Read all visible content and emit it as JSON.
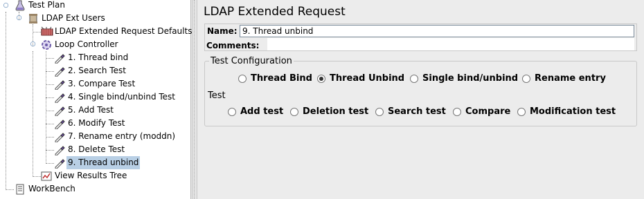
{
  "tree": {
    "test_plan": "Test Plan",
    "thread_group": "LDAP Ext Users",
    "defaults": "LDAP Extended Request Defaults",
    "loop_controller": "Loop Controller",
    "samplers": [
      "1. Thread bind",
      "2. Search Test",
      "3. Compare Test",
      "4. Single bind/unbind Test",
      "5. Add Test",
      "6. Modify Test",
      "7. Rename entry (moddn)",
      "8. Delete Test",
      "9. Thread unbind"
    ],
    "results_tree": "View Results Tree",
    "workbench": "WorkBench",
    "selected_index": 8
  },
  "panel": {
    "title": "LDAP Extended Request",
    "name_label": "Name:",
    "name_value": "9. Thread unbind",
    "comments_label": "Comments:",
    "config_label": "Test Configuration",
    "config_options": [
      "Thread Bind",
      "Thread Unbind",
      "Single bind/unbind",
      "Rename entry"
    ],
    "config_selected": "Thread Unbind",
    "test_label": "Test",
    "test_options": [
      "Add test",
      "Deletion test",
      "Search test",
      "Compare",
      "Modification test"
    ]
  },
  "icons": {
    "test_plan": "flask-icon",
    "thread_group": "spool-icon",
    "defaults": "config-element-icon",
    "loop_controller": "loop-icon",
    "sampler": "pipette-icon",
    "results_tree": "listener-icon",
    "workbench": "workbench-icon"
  }
}
